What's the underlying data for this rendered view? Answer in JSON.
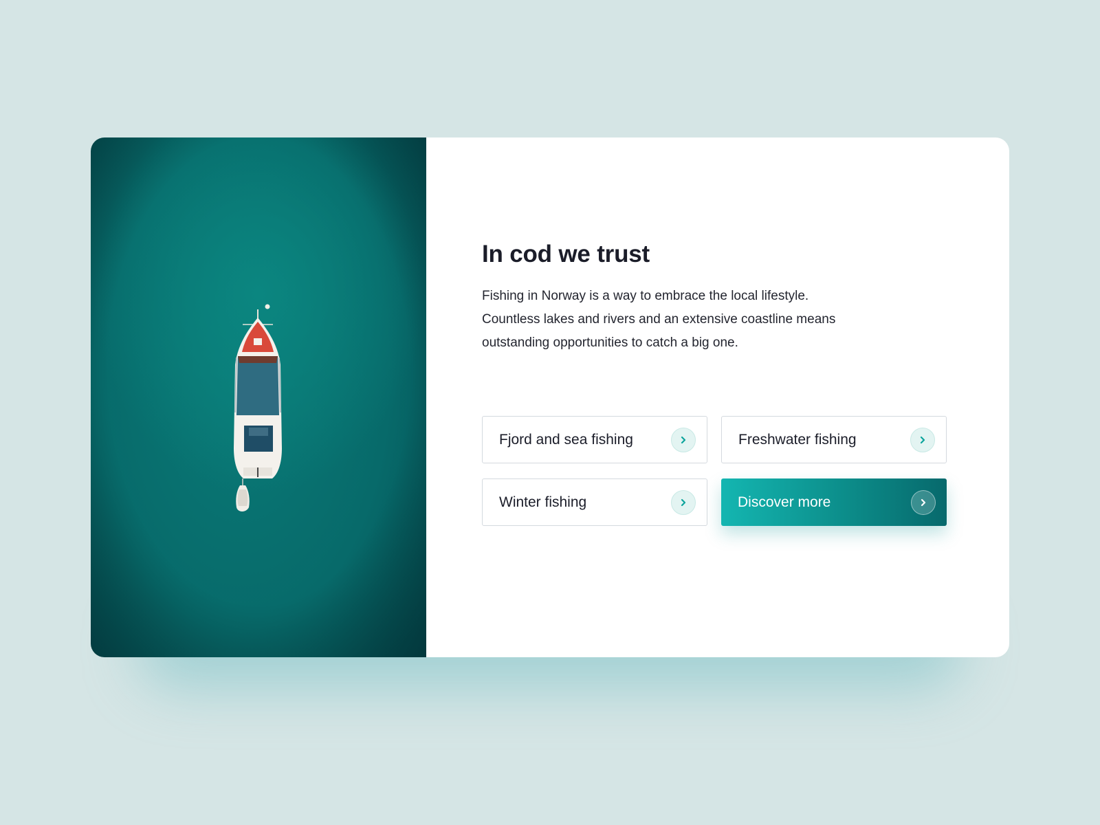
{
  "hero": {
    "image_alt": "boat-on-teal-water"
  },
  "content": {
    "title": "In cod we trust",
    "description": "Fishing in Norway is a way to embrace the local lifestyle. Countless lakes and rivers and an extensive coastline means outstanding opportunities to catch a big one."
  },
  "links": [
    {
      "label": "Fjord and sea fishing",
      "icon": "chevron-right-icon"
    },
    {
      "label": "Freshwater fishing",
      "icon": "chevron-right-icon"
    },
    {
      "label": "Winter fishing",
      "icon": "chevron-right-icon"
    },
    {
      "label": "Discover more",
      "icon": "chevron-right-icon"
    }
  ],
  "colors": {
    "background": "#d5e5e5",
    "accent": "#14b6b1",
    "accent_dark": "#07696c",
    "text": "#1b1d29"
  }
}
